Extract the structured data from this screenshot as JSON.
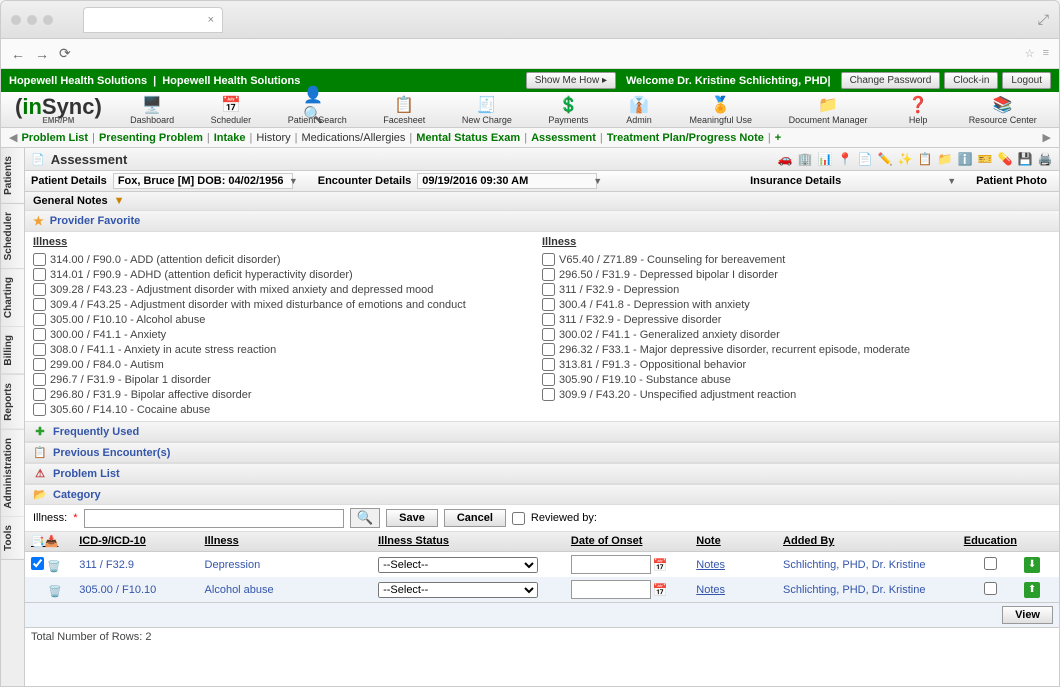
{
  "browser": {
    "tab_close": "×",
    "expand": "⤢"
  },
  "green_bar": {
    "org1": "Hopewell Health Solutions",
    "org2": "Hopewell Health Solutions",
    "show_me": "Show Me How ▸",
    "welcome": "Welcome Dr. Kristine Schlichting, PHD|",
    "change_pw": "Change Password",
    "clockin": "Clock-in",
    "logout": "Logout"
  },
  "logo": {
    "in": "in",
    "sync": "Sync",
    "sub": "EMR/PM"
  },
  "toolbar": [
    {
      "label": "Dashboard",
      "icon": "🖥️"
    },
    {
      "label": "Scheduler",
      "icon": "📅"
    },
    {
      "label": "Patient Search",
      "icon": "👤🔍"
    },
    {
      "label": "Facesheet",
      "icon": "📋"
    },
    {
      "label": "New Charge",
      "icon": "🧾"
    },
    {
      "label": "Payments",
      "icon": "💲"
    },
    {
      "label": "Admin",
      "icon": "👔"
    },
    {
      "label": "Meaningful Use",
      "icon": "🏅"
    },
    {
      "label": "Document Manager",
      "icon": "📁"
    },
    {
      "label": "Help",
      "icon": "❓"
    },
    {
      "label": "Resource Center",
      "icon": "📚"
    }
  ],
  "subnav": {
    "items": [
      {
        "label": "Problem List",
        "link": true
      },
      {
        "label": "Presenting Problem",
        "link": true
      },
      {
        "label": "Intake",
        "link": true
      },
      {
        "label": "History",
        "link": false
      },
      {
        "label": "Medications/Allergies",
        "link": false
      },
      {
        "label": "Mental Status Exam",
        "link": true
      },
      {
        "label": "Assessment",
        "link": true
      },
      {
        "label": "Treatment Plan/Progress Note",
        "link": true
      }
    ],
    "plus": "+"
  },
  "side_tabs": [
    "Patients",
    "Scheduler",
    "Charting",
    "Billing",
    "Reports",
    "Administration",
    "Tools"
  ],
  "page": {
    "title": "Assessment",
    "patient_details_label": "Patient Details",
    "patient_details_value": "Fox, Bruce [M] DOB: 04/02/1956",
    "encounter_label": "Encounter Details",
    "encounter_value": "09/19/2016 09:30 AM",
    "insurance_label": "Insurance Details",
    "photo_label": "Patient Photo"
  },
  "general_notes": "General Notes",
  "provider_favorite": "Provider Favorite",
  "illness_header": "Illness",
  "illness_left": [
    "314.00 / F90.0 - ADD (attention deficit disorder)",
    "314.01 / F90.9 - ADHD (attention deficit hyperactivity disorder)",
    "309.28 / F43.23 - Adjustment disorder with mixed anxiety and depressed mood",
    "309.4 / F43.25 - Adjustment disorder with mixed disturbance of emotions and conduct",
    "305.00 / F10.10 - Alcohol abuse",
    "300.00 / F41.1 - Anxiety",
    "308.0 / F41.1 - Anxiety in acute stress reaction",
    "299.00 / F84.0 - Autism",
    "296.7 / F31.9 - Bipolar 1 disorder",
    "296.80 / F31.9 - Bipolar affective disorder",
    "305.60 / F14.10 - Cocaine abuse"
  ],
  "illness_right": [
    "V65.40 / Z71.89 - Counseling for bereavement",
    "296.50 / F31.9 - Depressed bipolar I disorder",
    "311 / F32.9 - Depression",
    "300.4 / F41.8 - Depression with anxiety",
    "311 / F32.9 - Depressive disorder",
    "300.02 / F41.1 - Generalized anxiety disorder",
    "296.32 / F33.1 - Major depressive disorder, recurrent episode, moderate",
    "313.81 / F91.3 - Oppositional behavior",
    "305.90 / F19.10 - Substance abuse",
    "309.9 / F43.20 - Unspecified adjustment reaction"
  ],
  "sections": {
    "freq_used": "Frequently Used",
    "prev_enc": "Previous Encounter(s)",
    "problem_list": "Problem List",
    "category": "Category"
  },
  "search": {
    "label": "Illness:",
    "save": "Save",
    "cancel": "Cancel",
    "reviewed": "Reviewed by:"
  },
  "table": {
    "headers": {
      "icd": "ICD-9/ICD-10",
      "illness": "Illness",
      "status": "Illness Status",
      "date": "Date of Onset",
      "note": "Note",
      "added": "Added By",
      "edu": "Education"
    },
    "rows": [
      {
        "checked": true,
        "icd": "311 / F32.9",
        "illness": "Depression",
        "status": "--Select--",
        "date": "",
        "note": "Notes",
        "added": "Schlichting, PHD, Dr. Kristine",
        "arrow": "down"
      },
      {
        "checked": false,
        "icd": "305.00 / F10.10",
        "illness": "Alcohol abuse",
        "status": "--Select--",
        "date": "",
        "note": "Notes",
        "added": "Schlichting, PHD, Dr. Kristine",
        "arrow": "up"
      }
    ],
    "view": "View",
    "total": "Total Number of Rows: 2"
  }
}
